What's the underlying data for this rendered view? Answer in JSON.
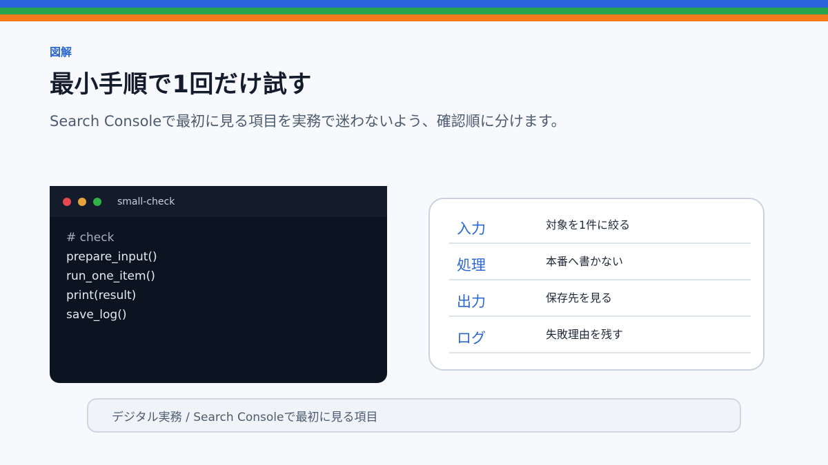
{
  "colors": {
    "stripe_blue": "#2a62dc",
    "stripe_green": "#26a34c",
    "stripe_orange": "#f27a1a",
    "accent": "#2a67d6",
    "dot_red": "#e5484d",
    "dot_yellow": "#e9a23b",
    "dot_green": "#2fb344"
  },
  "header": {
    "eyebrow": "図解",
    "title": "最小手順で1回だけ試す",
    "subtitle": "Search Consoleで最初に見る項目を実務で迷わないよう、確認順に分けます。"
  },
  "terminal": {
    "window_title": "small-check",
    "lines": [
      "# check",
      "prepare_input()",
      "run_one_item()",
      "print(result)",
      "save_log()"
    ]
  },
  "steps": [
    {
      "key": "入力",
      "value": "対象を1件に絞る"
    },
    {
      "key": "処理",
      "value": "本番へ書かない"
    },
    {
      "key": "出力",
      "value": "保存先を見る"
    },
    {
      "key": "ログ",
      "value": "失敗理由を残す"
    }
  ],
  "footer": {
    "breadcrumb": "デジタル実務 / Search Consoleで最初に見る項目"
  }
}
